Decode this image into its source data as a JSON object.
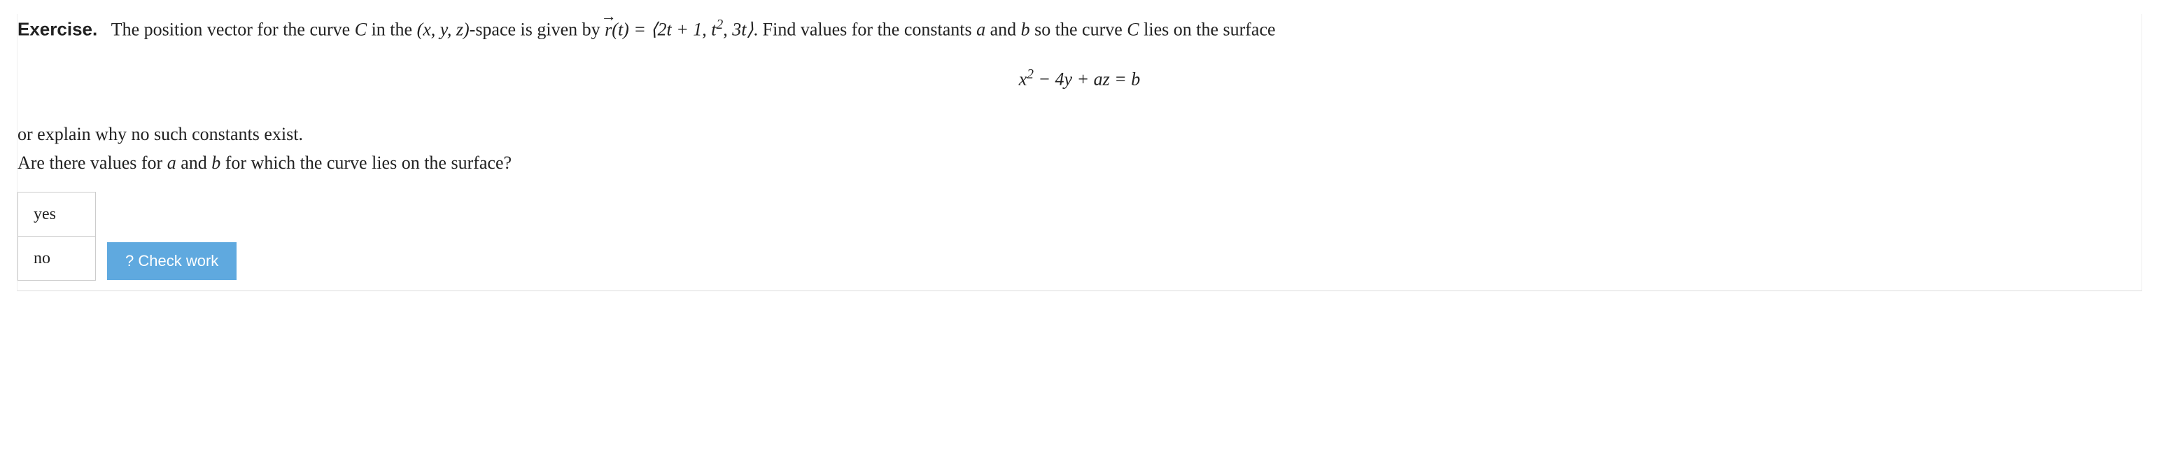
{
  "exercise": {
    "label": "Exercise.",
    "prompt_before": "The position vector for the curve ",
    "curve_name": "C",
    "prompt_mid1": " in the ",
    "space_vars": "(x, y, z)",
    "prompt_mid2": "-space is given by ",
    "vector_sym": "r",
    "vector_arg": "(t) = ⟨2t + 1, t",
    "vector_exp": "2",
    "vector_tail": ", 3t⟩",
    "prompt_after": ". Find values for the constants ",
    "const_a": "a",
    "prompt_and": " and ",
    "const_b": "b",
    "prompt_end1": " so the curve ",
    "curve_name2": "C",
    "prompt_end2": " lies on the surface"
  },
  "equation": {
    "lhs1": "x",
    "exp": "2",
    "lhs2": " − 4y + az = b"
  },
  "followup": {
    "line1_a": "or explain why no such constants exist.",
    "line2_a": "Are there values for ",
    "a": "a",
    "and": " and ",
    "b": "b",
    "line2_b": " for which the curve lies on the surface?"
  },
  "options": {
    "yes": "yes",
    "no": "no"
  },
  "buttons": {
    "check": "? Check work"
  }
}
